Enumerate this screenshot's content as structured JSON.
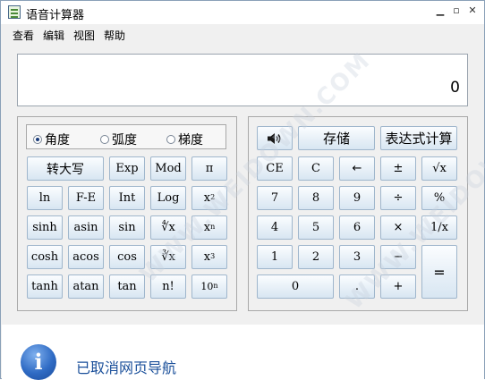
{
  "window": {
    "title": "语音计算器"
  },
  "menu": [
    "查看",
    "编辑",
    "视图",
    "帮助"
  ],
  "display": {
    "value": "0"
  },
  "angle_modes": [
    {
      "label": "角度",
      "selected": true
    },
    {
      "label": "弧度",
      "selected": false
    },
    {
      "label": "梯度",
      "selected": false
    }
  ],
  "sci": {
    "convert": "转大写",
    "exp": "Exp",
    "mod": "Mod",
    "pi": "π",
    "ln": "ln",
    "fe": "F-E",
    "int": "Int",
    "log": "Log",
    "x2_base": "x",
    "x2_exp": "2",
    "sinh": "sinh",
    "asin": "asin",
    "sin": "sin",
    "yroot": "∜x",
    "xn_base": "x",
    "xn_exp": "n",
    "cosh": "cosh",
    "acos": "acos",
    "cos": "cos",
    "cbrt": "∛x",
    "x3_base": "x",
    "x3_exp": "3",
    "tanh": "tanh",
    "atan": "atan",
    "tan": "tan",
    "fact": "n!",
    "tenx_base": "10",
    "tenx_exp": "n"
  },
  "std": {
    "speaker": "speaker-icon",
    "memory": "存储",
    "expr": "表达式计算",
    "ce": "CE",
    "c": "C",
    "back": "←",
    "pm": "±",
    "sqrt": "√x",
    "d7": "7",
    "d8": "8",
    "d9": "9",
    "div": "÷",
    "pct": "%",
    "d4": "4",
    "d5": "5",
    "d6": "6",
    "mul": "×",
    "recip": "1/x",
    "d1": "1",
    "d2": "2",
    "d3": "3",
    "sub": "−",
    "eq": "=",
    "d0": "0",
    "dot": ".",
    "add": "+"
  },
  "footer": {
    "text": "已取消网页导航",
    "icon": "info-icon"
  },
  "watermark": "WWW.WEIDOWN.COM"
}
